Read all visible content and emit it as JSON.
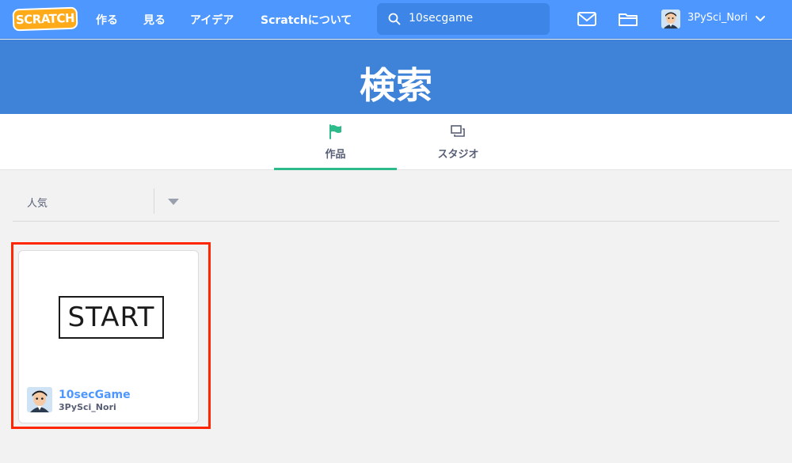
{
  "header": {
    "logo_text": "SCRATCH",
    "nav": [
      "作る",
      "見る",
      "アイデア",
      "Scratchについて"
    ],
    "search_value": "10secgame",
    "username": "3PySci_Nori",
    "brand_color": "#4d97ff"
  },
  "banner": {
    "title": "検索"
  },
  "tabs": [
    {
      "label": "作品",
      "icon": "flag-icon",
      "active": true,
      "accent": "#2dbb8b"
    },
    {
      "label": "スタジオ",
      "icon": "studio-icon",
      "active": false
    }
  ],
  "sort": {
    "selected": "人気"
  },
  "results": [
    {
      "title": "10secGame",
      "author": "3PySci_Nori",
      "thumbnail_text": "START"
    }
  ],
  "highlight_color": "#ff2600"
}
